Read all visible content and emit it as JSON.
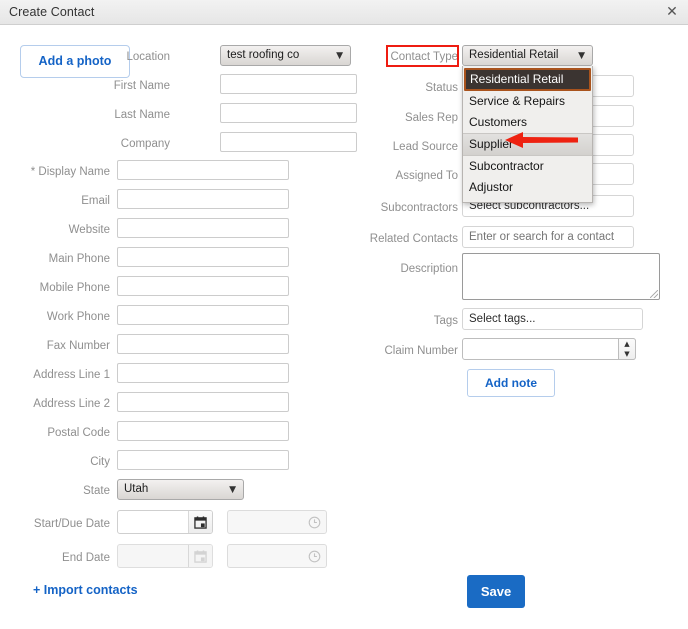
{
  "window": {
    "title": "Create Contact",
    "close_icon": "close-icon"
  },
  "photo": {
    "label": "Add a photo"
  },
  "left_fields": [
    {
      "label": "Location",
      "type": "select",
      "value": "test roofing co"
    },
    {
      "label": "First Name",
      "type": "text",
      "value": ""
    },
    {
      "label": "Last Name",
      "type": "text",
      "value": ""
    },
    {
      "label": "Company",
      "type": "text",
      "value": ""
    },
    {
      "label": "* Display Name",
      "type": "text",
      "value": ""
    },
    {
      "label": "Email",
      "type": "text",
      "value": ""
    },
    {
      "label": "Website",
      "type": "text",
      "value": ""
    },
    {
      "label": "Main Phone",
      "type": "text",
      "value": ""
    },
    {
      "label": "Mobile Phone",
      "type": "text",
      "value": ""
    },
    {
      "label": "Work Phone",
      "type": "text",
      "value": ""
    },
    {
      "label": "Fax Number",
      "type": "text",
      "value": ""
    },
    {
      "label": "Address Line 1",
      "type": "text",
      "value": ""
    },
    {
      "label": "Address Line 2",
      "type": "text",
      "value": ""
    },
    {
      "label": "Postal Code",
      "type": "text",
      "value": ""
    },
    {
      "label": "City",
      "type": "text",
      "value": ""
    },
    {
      "label": "State",
      "type": "select",
      "value": "Utah"
    },
    {
      "label": "Start/Due Date",
      "type": "datetime",
      "value": "",
      "time_value": ""
    },
    {
      "label": "End Date",
      "type": "datetime",
      "value": "",
      "time_value": ""
    }
  ],
  "right_fields": {
    "contact_type": {
      "label": "Contact Type",
      "value": "Residential Retail",
      "highlighted": true,
      "options": [
        "Residential Retail",
        "Service & Repairs",
        "Customers",
        "Supplier",
        "Subcontractor",
        "Adjustor"
      ],
      "selected_option": "Residential Retail",
      "hovered_option": "Supplier"
    },
    "status": {
      "label": "Status",
      "value": ""
    },
    "sales_rep": {
      "label": "Sales Rep",
      "value": ""
    },
    "lead_source": {
      "label": "Lead Source",
      "value": ""
    },
    "assigned_to": {
      "label": "Assigned To",
      "value": ""
    },
    "subcontractors": {
      "label": "Subcontractors",
      "value": "Select subcontractors..."
    },
    "related_contacts": {
      "label": "Related Contacts",
      "placeholder": "Enter or search for a contact"
    },
    "description": {
      "label": "Description",
      "value": ""
    },
    "tags": {
      "label": "Tags",
      "value": "Select tags..."
    },
    "claim_number": {
      "label": "Claim Number",
      "value": ""
    }
  },
  "buttons": {
    "add_note": "Add note",
    "save": "Save",
    "import_contacts": "+ Import contacts"
  },
  "icons": {
    "caret_down": "▼",
    "spinner_up": "▲",
    "spinner_down": "▼",
    "calendar": "▦",
    "clock": "◷",
    "close": "✕"
  },
  "colors": {
    "accent_blue": "#1463c6",
    "save_blue": "#1a6bc4",
    "annotation_red": "#ee1c11",
    "selected_item_bg": "#3b3431",
    "selected_item_border": "#a9531d"
  }
}
